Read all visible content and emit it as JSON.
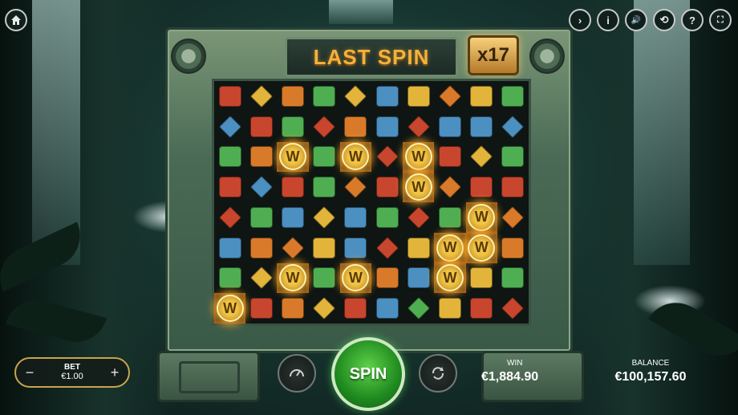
{
  "header": {
    "title": "LAST SPIN",
    "multiplier": "x17"
  },
  "bet": {
    "label": "BET",
    "value": "€1.00",
    "minus": "−",
    "plus": "+"
  },
  "win": {
    "label": "WIN",
    "value": "€1,884.90"
  },
  "balance": {
    "label": "BALANCE",
    "value": "€100,157.60"
  },
  "spin_button": {
    "label": "SPIN"
  },
  "top_buttons": {
    "home_icon": "home-icon",
    "icons": [
      "chevron-right-icon",
      "info-icon",
      "sound-icon",
      "history-icon",
      "help-icon",
      "fullscreen-icon"
    ],
    "glyphs": [
      "›",
      "i",
      "🔊",
      "⟲",
      "?",
      "⛶"
    ]
  },
  "wild_symbol": "W",
  "grid": {
    "rows": 8,
    "cols": 10,
    "cells": [
      "red",
      "yellow",
      "orange",
      "green",
      "yellow",
      "blue",
      "yellow",
      "orange",
      "yellow",
      "green",
      "blue",
      "red",
      "green",
      "red",
      "orange",
      "blue",
      "red",
      "blue",
      "blue",
      "blue",
      "green",
      "orange",
      "W",
      "green",
      "W",
      "red",
      "W",
      "red",
      "yellow",
      "green",
      "red",
      "blue",
      "red",
      "green",
      "orange",
      "red",
      "W",
      "orange",
      "red",
      "red",
      "red",
      "green",
      "blue",
      "yellow",
      "blue",
      "green",
      "red",
      "green",
      "W",
      "orange",
      "blue",
      "orange",
      "orange",
      "yellow",
      "blue",
      "red",
      "yellow",
      "W",
      "W",
      "orange",
      "green",
      "yellow",
      "W",
      "green",
      "W",
      "orange",
      "blue",
      "W",
      "yellow",
      "green",
      "W",
      "red",
      "orange",
      "yellow",
      "red",
      "blue",
      "green",
      "yellow",
      "red",
      "red"
    ]
  },
  "colors": {
    "red": "#c8452e",
    "yellow": "#e2b43a",
    "orange": "#d97a2a",
    "green": "#4fae52",
    "blue": "#4c8fc1",
    "wild": "#f0c545"
  }
}
